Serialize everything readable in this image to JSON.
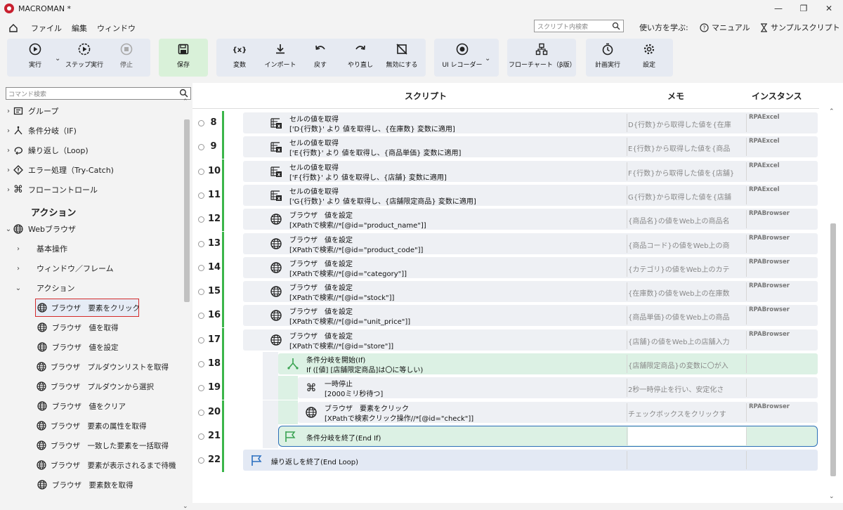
{
  "app": {
    "title": "MACROMAN *"
  },
  "menu": {
    "items": [
      "ファイル",
      "編集",
      "ウィンドウ"
    ]
  },
  "search": {
    "placeholder": "スクリプト内検索"
  },
  "help": {
    "learn": "使い方を学ぶ:",
    "manual": "マニュアル",
    "sample": "サンプルスクリプト"
  },
  "toolbar": {
    "run": "実行",
    "step": "ステップ実行",
    "stop": "停止",
    "save": "保存",
    "variable": "変数",
    "import": "インポート",
    "undo": "戻す",
    "redo": "やり直し",
    "disable": "無効にする",
    "uirec": "UI レコーダー",
    "flow": "フローチャート（β版）",
    "schedule": "計画実行",
    "settings": "設定"
  },
  "left": {
    "search_placeholder": "コマンド検索",
    "categories": [
      "グループ",
      "条件分岐（IF)",
      "繰り返し（Loop)",
      "エラー処理（Try-Catch)",
      "フローコントロール"
    ],
    "action_heading": "アクション",
    "web": "Webブラウザ",
    "sub": [
      "基本操作",
      "ウィンドウ／フレーム",
      "アクション"
    ],
    "actions": [
      "ブラウザ　要素をクリック",
      "ブラウザ　値を取得",
      "ブラウザ　値を設定",
      "ブラウザ　プルダウンリストを取得",
      "ブラウザ　プルダウンから選択",
      "ブラウザ　値をクリア",
      "ブラウザ　要素の属性を取得",
      "ブラウザ　一致した要素を一括取得",
      "ブラウザ　要素が表示されるまで待機",
      "ブラウザ　要素数を取得"
    ]
  },
  "header": {
    "script": "スクリプト",
    "memo": "メモ",
    "instance": "インスタンス"
  },
  "rows": [
    {
      "n": "8",
      "t1": "セルの値を取得",
      "t2": "['D{行数}' より 値を取得し、{在庫数} 変数に適用]",
      "memo": "D{行数}から取得した値を{在庫",
      "inst": "RPAExcel",
      "icon": "excel"
    },
    {
      "n": "9",
      "t1": "セルの値を取得",
      "t2": "['E{行数}' より 値を取得し、{商品単価} 変数に適用]",
      "memo": "E{行数}から取得した値を{商品",
      "inst": "RPAExcel",
      "icon": "excel"
    },
    {
      "n": "10",
      "t1": "セルの値を取得",
      "t2": "['F{行数}' より 値を取得し、{店舗} 変数に適用]",
      "memo": "F{行数}から取得した値を{店舗}",
      "inst": "RPAExcel",
      "icon": "excel"
    },
    {
      "n": "11",
      "t1": "セルの値を取得",
      "t2": "['G{行数}' より 値を取得し、{店舗限定商品} 変数に適用]",
      "memo": "G{行数}から取得した値を{店舗",
      "inst": "RPAExcel",
      "icon": "excel"
    },
    {
      "n": "12",
      "t1": "ブラウザ　値を設定",
      "t2": "[XPathで検索//*[@id=\"product_name\"]]",
      "memo": "{商品名}の値をWeb上の商品名",
      "inst": "RPABrowser",
      "icon": "globe"
    },
    {
      "n": "13",
      "t1": "ブラウザ　値を設定",
      "t2": "[XPathで検索//*[@id=\"product_code\"]]",
      "memo": "{商品コード}の値をWeb上の商",
      "inst": "RPABrowser",
      "icon": "globe"
    },
    {
      "n": "14",
      "t1": "ブラウザ　値を設定",
      "t2": "[XPathで検索//*[@id=\"category\"]]",
      "memo": "{カテゴリ}の値をWeb上のカテ",
      "inst": "RPABrowser",
      "icon": "globe"
    },
    {
      "n": "15",
      "t1": "ブラウザ　値を設定",
      "t2": "[XPathで検索//*[@id=\"stock\"]]",
      "memo": "{在庫数}の値をWeb上の在庫数",
      "inst": "RPABrowser",
      "icon": "globe"
    },
    {
      "n": "16",
      "t1": "ブラウザ　値を設定",
      "t2": "[XPathで検索//*[@id=\"unit_price\"]]",
      "memo": "{商品単価}の値をWeb上の商品",
      "inst": "RPABrowser",
      "icon": "globe"
    },
    {
      "n": "17",
      "t1": "ブラウザ　値を設定",
      "t2": "[XPathで検索//*[@id=\"store\"]]",
      "memo": "{店舗}の値をWeb上の店舗入力",
      "inst": "RPABrowser",
      "icon": "globe"
    },
    {
      "n": "18",
      "t1": "条件分岐を開始(If)",
      "t2": "If ([値] [店舗限定商品]は〇に等しい)",
      "memo": "{店舗限定商品}の変数に〇が入",
      "inst": "",
      "icon": "if"
    },
    {
      "n": "19",
      "t1": "一時停止",
      "t2": "[2000ミリ秒待つ]",
      "memo": "2秒一時停止を行い、安定化さ",
      "inst": "",
      "icon": "cmd"
    },
    {
      "n": "20",
      "t1": "ブラウザ　要素をクリック",
      "t2": "[XPathで検索クリック操作//*[@id=\"check\"]]",
      "memo": "チェックボックスをクリックす",
      "inst": "RPABrowser",
      "icon": "globe"
    },
    {
      "n": "21",
      "t1": "条件分岐を終了(End If)",
      "t2": "",
      "memo": "",
      "inst": "",
      "icon": "flag-green"
    },
    {
      "n": "22",
      "t1": "繰り返しを終了(End Loop)",
      "t2": "",
      "memo": "",
      "inst": "",
      "icon": "flag-blue"
    }
  ]
}
